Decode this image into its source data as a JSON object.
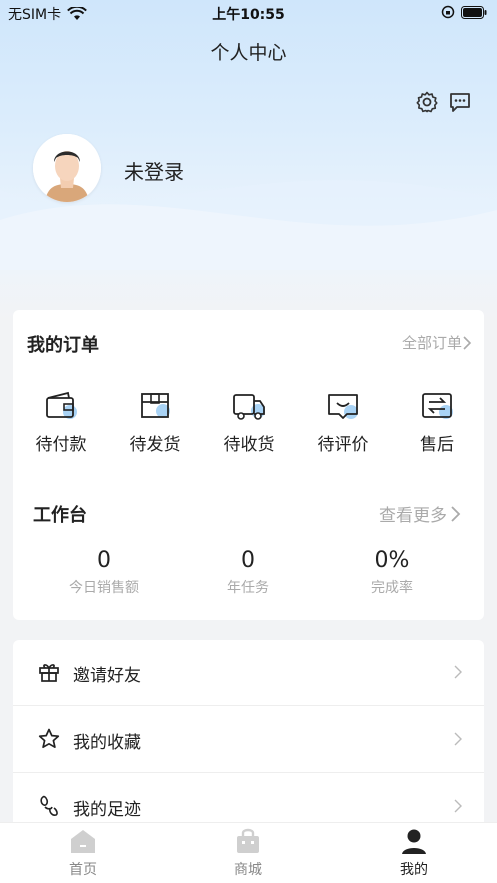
{
  "status_bar": {
    "carrier": "无SIM卡",
    "time": "上午10:55"
  },
  "header": {
    "title": "个人中心"
  },
  "profile": {
    "login_status": "未登录"
  },
  "orders": {
    "title": "我的订单",
    "all_link": "全部订单",
    "items": [
      {
        "label": "待付款",
        "icon": "wallet-icon"
      },
      {
        "label": "待发货",
        "icon": "box-icon"
      },
      {
        "label": "待收货",
        "icon": "truck-icon"
      },
      {
        "label": "待评价",
        "icon": "comment-icon"
      },
      {
        "label": "售后",
        "icon": "exchange-icon"
      }
    ]
  },
  "workbench": {
    "title": "工作台",
    "more_link": "查看更多",
    "stats": [
      {
        "value": "0",
        "label": "今日销售额"
      },
      {
        "value": "0",
        "label": "年任务"
      },
      {
        "value": "0%",
        "label": "完成率"
      }
    ]
  },
  "menu": [
    {
      "label": "邀请好友",
      "icon": "gift-icon"
    },
    {
      "label": "我的收藏",
      "icon": "star-icon"
    },
    {
      "label": "我的足迹",
      "icon": "footprint-icon"
    }
  ],
  "tabbar": [
    {
      "label": "首页",
      "icon": "home-icon"
    },
    {
      "label": "商城",
      "icon": "shop-bag-icon"
    },
    {
      "label": "我的",
      "icon": "user-icon",
      "active": true
    }
  ],
  "colors": {
    "accent_light_blue": "#a9d3f5",
    "hero_bg": "#cfe6fb",
    "muted": "#aaaaaa"
  }
}
